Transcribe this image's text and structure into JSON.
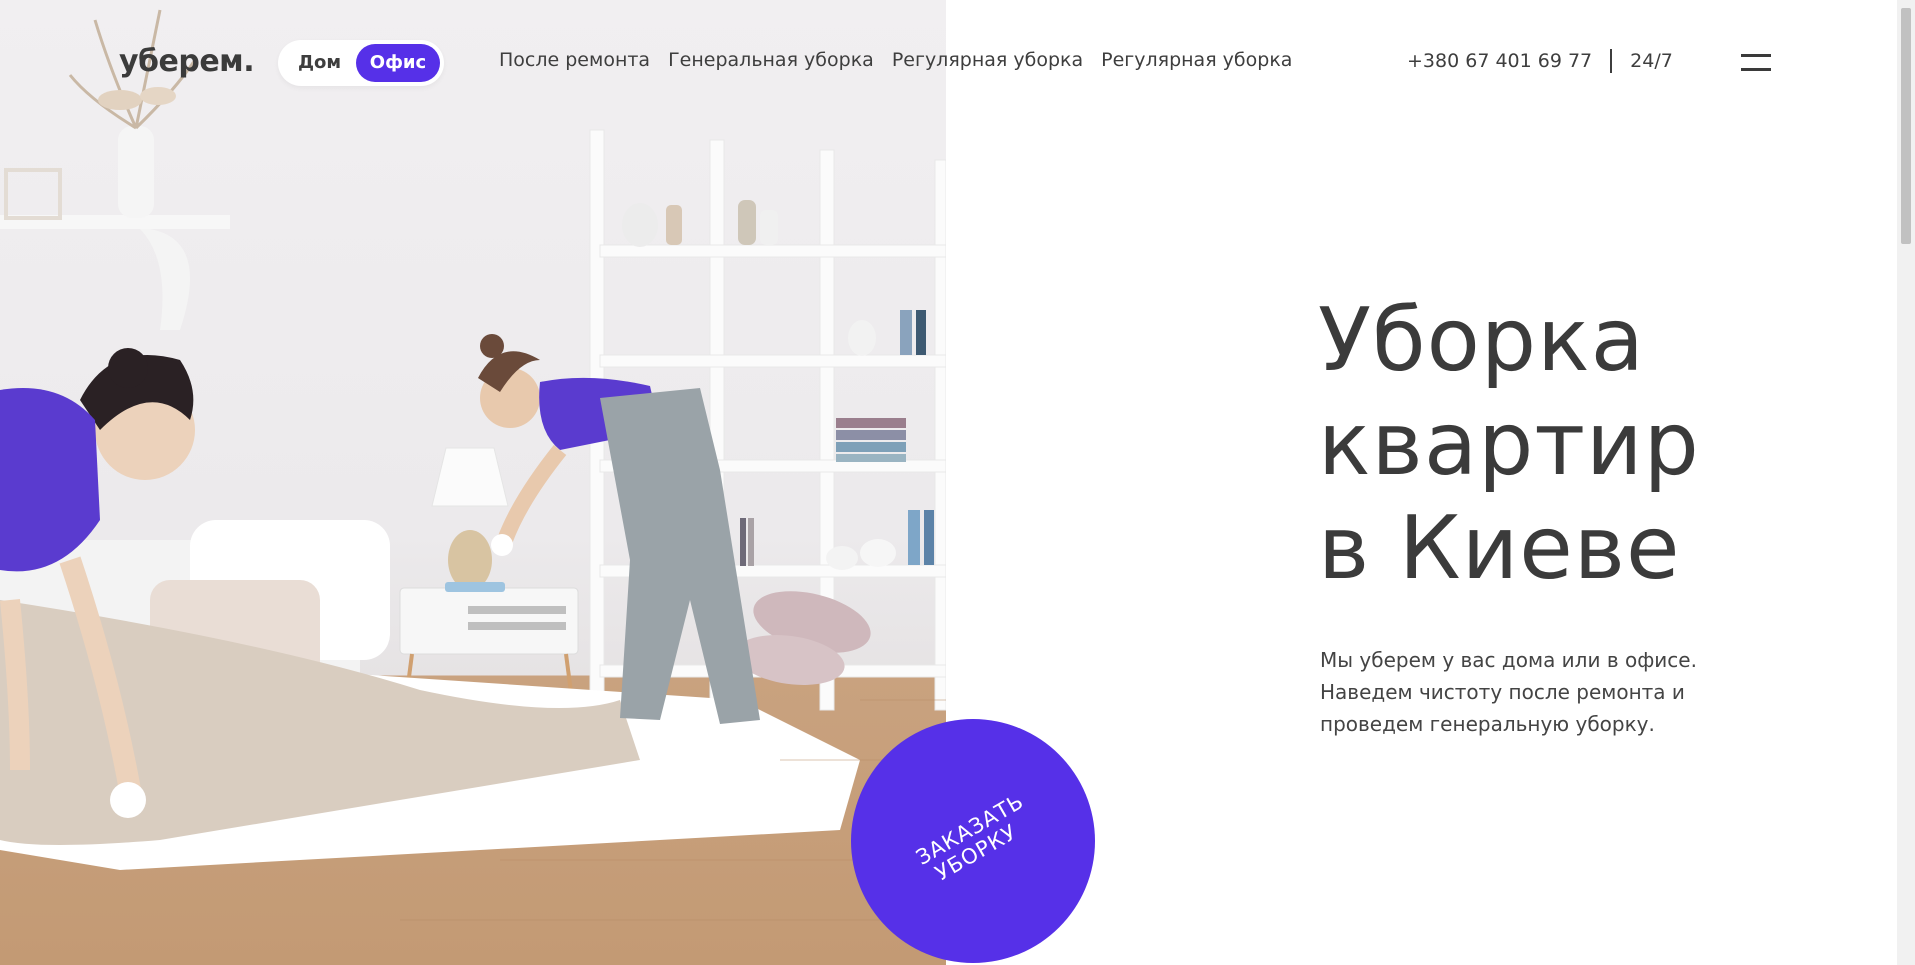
{
  "header": {
    "logo": "уберем.",
    "toggle": {
      "home": "Дом",
      "office": "Офис"
    },
    "nav": [
      "После ремонта",
      "Генеральная уборка",
      "Регулярная уборка",
      "Регулярная уборка"
    ],
    "phone": "+380 67 401 69 77",
    "hours": "24/7"
  },
  "hero": {
    "title_lines": [
      "Уборка",
      "квартир",
      "в Киеве"
    ],
    "subtitle_lines": [
      "Мы уберем у вас дома или в офисе.",
      "Наведем чистоту после ремонта и",
      "проведем генеральную уборку."
    ],
    "cta_lines": [
      "ЗАКАЗАТЬ",
      "УБОРКУ"
    ]
  },
  "colors": {
    "accent": "#5630e8",
    "text": "#3b3b3b",
    "background": "#ffffff"
  },
  "icons": {
    "menu": "hamburger-icon"
  }
}
